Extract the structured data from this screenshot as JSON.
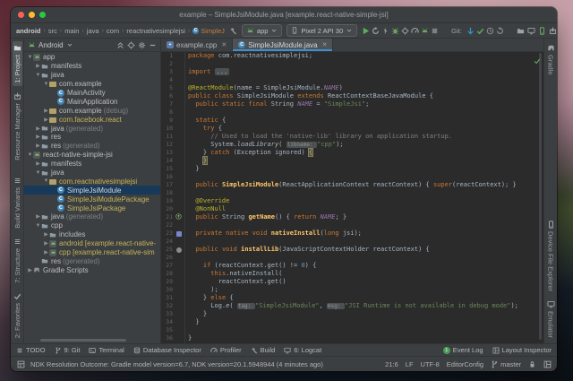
{
  "colors": {
    "accent_blue": "#3d8fd2",
    "run_green": "#499c54",
    "git_blue": "#3592c4",
    "modified_yellow": "#c5b35c",
    "keyword": "#cc7832",
    "string": "#6a8759",
    "annotation": "#bbb529",
    "field": "#9876aa",
    "method": "#ffc66b",
    "editor_bg": "#2b2b2b",
    "panel_bg": "#3c3f41",
    "selection": "#17395a",
    "mac_red": "#ff5f57",
    "mac_yellow": "#febc2e",
    "mac_green": "#28c840"
  },
  "window": {
    "title": "example – SimpleJsiModule.java [example.react-native-simple-jsi]"
  },
  "navbar": {
    "breadcrumbs": [
      "android",
      "src",
      "main",
      "java",
      "com",
      "reactnativesimplejsi"
    ],
    "breadcrumb_class": "SimpleJ",
    "run_config": "app",
    "device": "Pixel 2 API 30",
    "git_label": "Git:",
    "run_icons": [
      {
        "name": "run-button",
        "icon": "play",
        "color": "#5caf5e"
      },
      {
        "name": "apply-changes-button",
        "icon": "refresh",
        "color": "#9fa2a4"
      },
      {
        "name": "apply-code-changes-button",
        "icon": "lightning",
        "color": "#9fa2a4"
      },
      {
        "name": "debug-button",
        "icon": "bug",
        "color": "#6ba862"
      },
      {
        "name": "attach-debugger-button",
        "icon": "target",
        "color": "#9fa2a4"
      },
      {
        "name": "profiler-button",
        "icon": "gauge",
        "color": "#9fa2a4"
      },
      {
        "name": "record-button",
        "icon": "android",
        "color": "#6ba862"
      },
      {
        "name": "stop-button",
        "icon": "stop",
        "color": "#7d8083"
      }
    ],
    "git_icons": [
      {
        "name": "git-update-button",
        "icon": "arrow-down",
        "color": "#3592c4"
      },
      {
        "name": "git-commit-button",
        "icon": "check",
        "color": "#5caf5e"
      },
      {
        "name": "git-history-button",
        "icon": "clock",
        "color": "#8a8d90"
      },
      {
        "name": "git-rollback-button",
        "icon": "rollback",
        "color": "#8a8d90"
      }
    ],
    "right_icons": [
      {
        "name": "sync-gradle-button",
        "icon": "folder",
        "color": "#9fa2a4"
      },
      {
        "name": "device-monitor-button",
        "icon": "monitor",
        "color": "#9fa2a4"
      },
      {
        "name": "avd-manager-button",
        "icon": "phone",
        "color": "#6ba862"
      },
      {
        "name": "sdk-manager-button",
        "icon": "box",
        "color": "#9fa2a4"
      },
      {
        "name": "search-everywhere-button",
        "icon": "search",
        "color": "#b5b7b9"
      }
    ]
  },
  "left_strip": {
    "top": [
      {
        "label": "1: Project",
        "icon": "folder",
        "active": true
      },
      {
        "label": "Resource Manager",
        "icon": "box",
        "active": false
      }
    ],
    "bottom": [
      {
        "label": "Build Variants",
        "icon": "list",
        "active": false
      },
      {
        "label": "7: Structure",
        "icon": "list",
        "active": false
      },
      {
        "label": "2: Favorites",
        "icon": "check",
        "active": false
      }
    ]
  },
  "right_strip": {
    "top": [
      {
        "label": "Gradle",
        "icon": "elephant",
        "active": false
      }
    ],
    "bottom": [
      {
        "label": "Device File Explorer",
        "icon": "phone",
        "active": false
      },
      {
        "label": "Emulator",
        "icon": "monitor",
        "active": false
      }
    ]
  },
  "project_panel": {
    "mode": "Android",
    "header_icons": [
      {
        "name": "collapse-all-button",
        "icon": "collapse",
        "color": "#9fa2a4"
      },
      {
        "name": "locate-file-button",
        "icon": "target",
        "color": "#9fa2a4"
      },
      {
        "name": "settings-button",
        "icon": "gear",
        "color": "#9fa2a4"
      },
      {
        "name": "hide-panel-button",
        "icon": "minus",
        "color": "#9fa2a4"
      }
    ],
    "tree": [
      {
        "d": 0,
        "a": "d",
        "i": "module",
        "t": "app"
      },
      {
        "d": 1,
        "a": "r",
        "i": "folder",
        "t": "manifests"
      },
      {
        "d": 1,
        "a": "d",
        "i": "folder",
        "t": "java"
      },
      {
        "d": 2,
        "a": "d",
        "i": "package",
        "t": "com.example"
      },
      {
        "d": 3,
        "a": "",
        "i": "class",
        "t": "MainActivity"
      },
      {
        "d": 3,
        "a": "",
        "i": "class",
        "t": "MainApplication"
      },
      {
        "d": 2,
        "a": "r",
        "i": "package",
        "t": "com.example",
        "s": "(debug)"
      },
      {
        "d": 2,
        "a": "r",
        "i": "package",
        "t": "com.facebook.react",
        "c": "mod"
      },
      {
        "d": 1,
        "a": "r",
        "i": "folder",
        "t": "java",
        "s": "(generated)"
      },
      {
        "d": 1,
        "a": "r",
        "i": "folder",
        "t": "res"
      },
      {
        "d": 1,
        "a": "r",
        "i": "folder",
        "t": "res",
        "s": "(generated)"
      },
      {
        "d": 0,
        "a": "d",
        "i": "module",
        "t": "react-native-simple-jsi"
      },
      {
        "d": 1,
        "a": "r",
        "i": "folder",
        "t": "manifests"
      },
      {
        "d": 1,
        "a": "d",
        "i": "folder",
        "t": "java"
      },
      {
        "d": 2,
        "a": "d",
        "i": "package",
        "t": "com.reactnativesimplejsi",
        "c": "mod"
      },
      {
        "d": 3,
        "a": "",
        "i": "class",
        "t": "SimpleJsiModule",
        "sel": true
      },
      {
        "d": 3,
        "a": "",
        "i": "class",
        "t": "SimpleJsiModulePackage",
        "c": "mod"
      },
      {
        "d": 3,
        "a": "",
        "i": "class",
        "t": "SimpleJsiPackage",
        "c": "mod"
      },
      {
        "d": 1,
        "a": "r",
        "i": "folder",
        "t": "java",
        "s": "(generated)"
      },
      {
        "d": 1,
        "a": "d",
        "i": "folder",
        "t": "cpp"
      },
      {
        "d": 2,
        "a": "r",
        "i": "folder",
        "t": "includes"
      },
      {
        "d": 2,
        "a": "r",
        "i": "module",
        "t": "android [example.react-native-",
        "c": "mod"
      },
      {
        "d": 2,
        "a": "r",
        "i": "module",
        "t": "cpp [example.react-native-sim",
        "c": "mod"
      },
      {
        "d": 1,
        "a": "",
        "i": "folder",
        "t": "res",
        "s": "(generated)"
      },
      {
        "d": 0,
        "a": "r",
        "i": "gradle",
        "t": "Gradle Scripts"
      }
    ]
  },
  "tabs": [
    {
      "label": "example.cpp",
      "icon": "cpp",
      "active": false
    },
    {
      "label": "SimpleJsiModule.java",
      "icon": "class",
      "active": true
    }
  ],
  "editor": {
    "gutter_icons": {
      "21": "override",
      "23": "native",
      "25": "bound"
    },
    "lines": [
      {
        "n": 1,
        "s": [
          [
            "package",
            "kw"
          ],
          [
            " com.reactnativesimplejsi;",
            "txt"
          ]
        ]
      },
      {
        "n": 2,
        "s": []
      },
      {
        "n": 3,
        "s": [
          [
            "import",
            "kw"
          ],
          [
            " ",
            "txt"
          ],
          [
            "...",
            "fold"
          ]
        ]
      },
      {
        "n": 4,
        "s": []
      },
      {
        "n": 5,
        "s": [
          [
            "@ReactModule",
            "ann"
          ],
          [
            "(name = SimpleJsiModule.",
            "txt"
          ],
          [
            "NAME",
            "fld"
          ],
          [
            ")",
            "txt"
          ]
        ]
      },
      {
        "n": 6,
        "s": [
          [
            "public class ",
            "kw"
          ],
          [
            "SimpleJsiModule ",
            "txt"
          ],
          [
            "extends ",
            "kw"
          ],
          [
            "ReactContextBaseJavaModule {",
            "txt"
          ]
        ]
      },
      {
        "n": 7,
        "s": [
          [
            "  ",
            "txt"
          ],
          [
            "public static final ",
            "kw"
          ],
          [
            "String ",
            "txt"
          ],
          [
            "NAME",
            "fld"
          ],
          [
            " = ",
            "txt"
          ],
          [
            "\"SimpleJsi\"",
            "str"
          ],
          [
            ";",
            "txt"
          ]
        ]
      },
      {
        "n": 8,
        "s": []
      },
      {
        "n": 9,
        "s": [
          [
            "  ",
            "txt"
          ],
          [
            "static",
            "kw"
          ],
          [
            " {",
            "txt"
          ]
        ]
      },
      {
        "n": 10,
        "s": [
          [
            "    ",
            "txt"
          ],
          [
            "try",
            "kw"
          ],
          [
            " {",
            "txt"
          ]
        ]
      },
      {
        "n": 11,
        "s": [
          [
            "      // Used to load the 'native-lib' library on application startup.",
            "com"
          ]
        ]
      },
      {
        "n": 12,
        "s": [
          [
            "      System.",
            "txt"
          ],
          [
            "loadLibrary",
            "sref"
          ],
          [
            "( ",
            "txt"
          ],
          [
            "libname: ",
            "hint"
          ],
          [
            "\"cpp\"",
            "str"
          ],
          [
            ");",
            "txt"
          ]
        ]
      },
      {
        "n": 13,
        "s": [
          [
            "    } ",
            "txt"
          ],
          [
            "catch",
            "kw"
          ],
          [
            " (Exception ignored) ",
            "txt"
          ],
          [
            "{",
            "brace"
          ]
        ]
      },
      {
        "n": 14,
        "s": [
          [
            "    ",
            "txt"
          ],
          [
            "}",
            "brace"
          ],
          [
            "",
            "caret"
          ]
        ]
      },
      {
        "n": 15,
        "s": [
          [
            "  }",
            "txt"
          ]
        ]
      },
      {
        "n": 16,
        "s": []
      },
      {
        "n": 17,
        "s": [
          [
            "  ",
            "txt"
          ],
          [
            "public ",
            "kw"
          ],
          [
            "SimpleJsiModule",
            "mth"
          ],
          [
            "(ReactApplicationContext reactContext) { ",
            "txt"
          ],
          [
            "super",
            "kw"
          ],
          [
            "(reactContext); }",
            "txt"
          ]
        ]
      },
      {
        "n": 18,
        "s": []
      },
      {
        "n": 19,
        "s": [
          [
            "  @Override",
            "ann"
          ]
        ]
      },
      {
        "n": 20,
        "s": [
          [
            "  @NonNull",
            "ann"
          ]
        ]
      },
      {
        "n": 21,
        "s": [
          [
            "  ",
            "txt"
          ],
          [
            "public ",
            "kw"
          ],
          [
            "String ",
            "txt"
          ],
          [
            "getName",
            "mth"
          ],
          [
            "() { ",
            "txt"
          ],
          [
            "return ",
            "kw"
          ],
          [
            "NAME",
            "fld"
          ],
          [
            "; }",
            "txt"
          ]
        ]
      },
      {
        "n": 22,
        "s": []
      },
      {
        "n": 23,
        "s": [
          [
            "  ",
            "txt"
          ],
          [
            "private native void ",
            "kw"
          ],
          [
            "nativeInstall",
            "mth"
          ],
          [
            "(",
            "txt"
          ],
          [
            "long ",
            "kw"
          ],
          [
            "jsi);",
            "txt"
          ]
        ]
      },
      {
        "n": 24,
        "s": []
      },
      {
        "n": 25,
        "s": [
          [
            "  ",
            "txt"
          ],
          [
            "public void ",
            "kw"
          ],
          [
            "installLib",
            "mth"
          ],
          [
            "(JavaScriptContextHolder reactContext) {",
            "txt"
          ]
        ]
      },
      {
        "n": 26,
        "s": []
      },
      {
        "n": 27,
        "s": [
          [
            "    ",
            "txt"
          ],
          [
            "if",
            "kw"
          ],
          [
            " (reactContext.get() != ",
            "txt"
          ],
          [
            "0",
            "num2"
          ],
          [
            ") {",
            "txt"
          ]
        ]
      },
      {
        "n": 28,
        "s": [
          [
            "      ",
            "txt"
          ],
          [
            "this",
            "kw"
          ],
          [
            ".nativeInstall(",
            "txt"
          ]
        ]
      },
      {
        "n": 29,
        "s": [
          [
            "        reactContext.get()",
            "txt"
          ]
        ]
      },
      {
        "n": 30,
        "s": [
          [
            "      );",
            "txt"
          ]
        ]
      },
      {
        "n": 31,
        "s": [
          [
            "    } ",
            "txt"
          ],
          [
            "else",
            "kw"
          ],
          [
            " {",
            "txt"
          ]
        ]
      },
      {
        "n": 32,
        "s": [
          [
            "      Log.",
            "txt"
          ],
          [
            "e",
            "sref"
          ],
          [
            "( ",
            "txt"
          ],
          [
            "tag: ",
            "hint"
          ],
          [
            "\"SimpleJsiModule\"",
            "str"
          ],
          [
            ", ",
            "txt"
          ],
          [
            "msg: ",
            "hint"
          ],
          [
            "\"JSI Runtime is not available in debug mode\"",
            "str"
          ],
          [
            ");",
            "txt"
          ]
        ]
      },
      {
        "n": 33,
        "s": [
          [
            "    }",
            "txt"
          ]
        ]
      },
      {
        "n": 34,
        "s": [
          [
            "  }",
            "txt"
          ]
        ]
      },
      {
        "n": 35,
        "s": []
      },
      {
        "n": 36,
        "s": [
          [
            "}",
            "txt"
          ]
        ]
      }
    ]
  },
  "bottom_bar": {
    "left": [
      {
        "label": "TODO",
        "icon": "list"
      },
      {
        "label": "9: Git",
        "icon": "branch"
      },
      {
        "label": "Terminal",
        "icon": "terminal"
      },
      {
        "label": "Database Inspector",
        "icon": "database"
      },
      {
        "label": "Profiler",
        "icon": "gauge"
      },
      {
        "label": "Build",
        "icon": "hammer"
      },
      {
        "label": "6: Logcat",
        "icon": "monitor"
      }
    ],
    "right": [
      {
        "label": "Event Log",
        "badge": "1"
      },
      {
        "label": "Layout Inspector",
        "icon": "layout"
      }
    ]
  },
  "status_bar": {
    "message": "NDK Resolution Outcome: Gradle model version=6.7, NDK version=20.1.5948944 (4 minutes ago)",
    "cursor": "21:6",
    "line_ending": "LF",
    "encoding": "UTF-8",
    "editorconfig": "EditorConfig",
    "branch": "master"
  }
}
